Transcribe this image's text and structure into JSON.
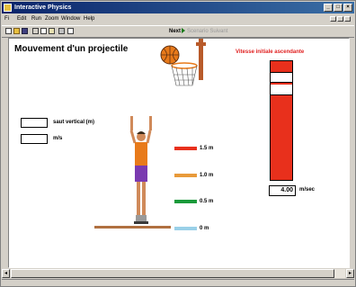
{
  "window": {
    "title": "Interactive Physics"
  },
  "menubar": {
    "items": [
      "Fi",
      "Edit",
      "Run",
      "Zoom",
      "Window",
      "Help"
    ]
  },
  "toolbar": {
    "next_label": "Next",
    "dim_label": "Scenario Suivant"
  },
  "canvas": {
    "heading": "Mouvement d'un projectile",
    "velocity_title": "Vitesse initiale ascendante",
    "velocity_value": "4.00",
    "velocity_unit": "m/sec",
    "fields": [
      {
        "label": "saut vertical (m)",
        "value": ""
      },
      {
        "label": "m/s",
        "value": ""
      }
    ],
    "markers": [
      {
        "label": "1.5 m",
        "color": "#e8301c"
      },
      {
        "label": "1.0 m",
        "color": "#e89a3a"
      },
      {
        "label": "0.5 m",
        "color": "#1a9a3a"
      },
      {
        "label": "0 m",
        "color": "#9ad0e8"
      }
    ],
    "ball_color": "#e87a1a"
  }
}
